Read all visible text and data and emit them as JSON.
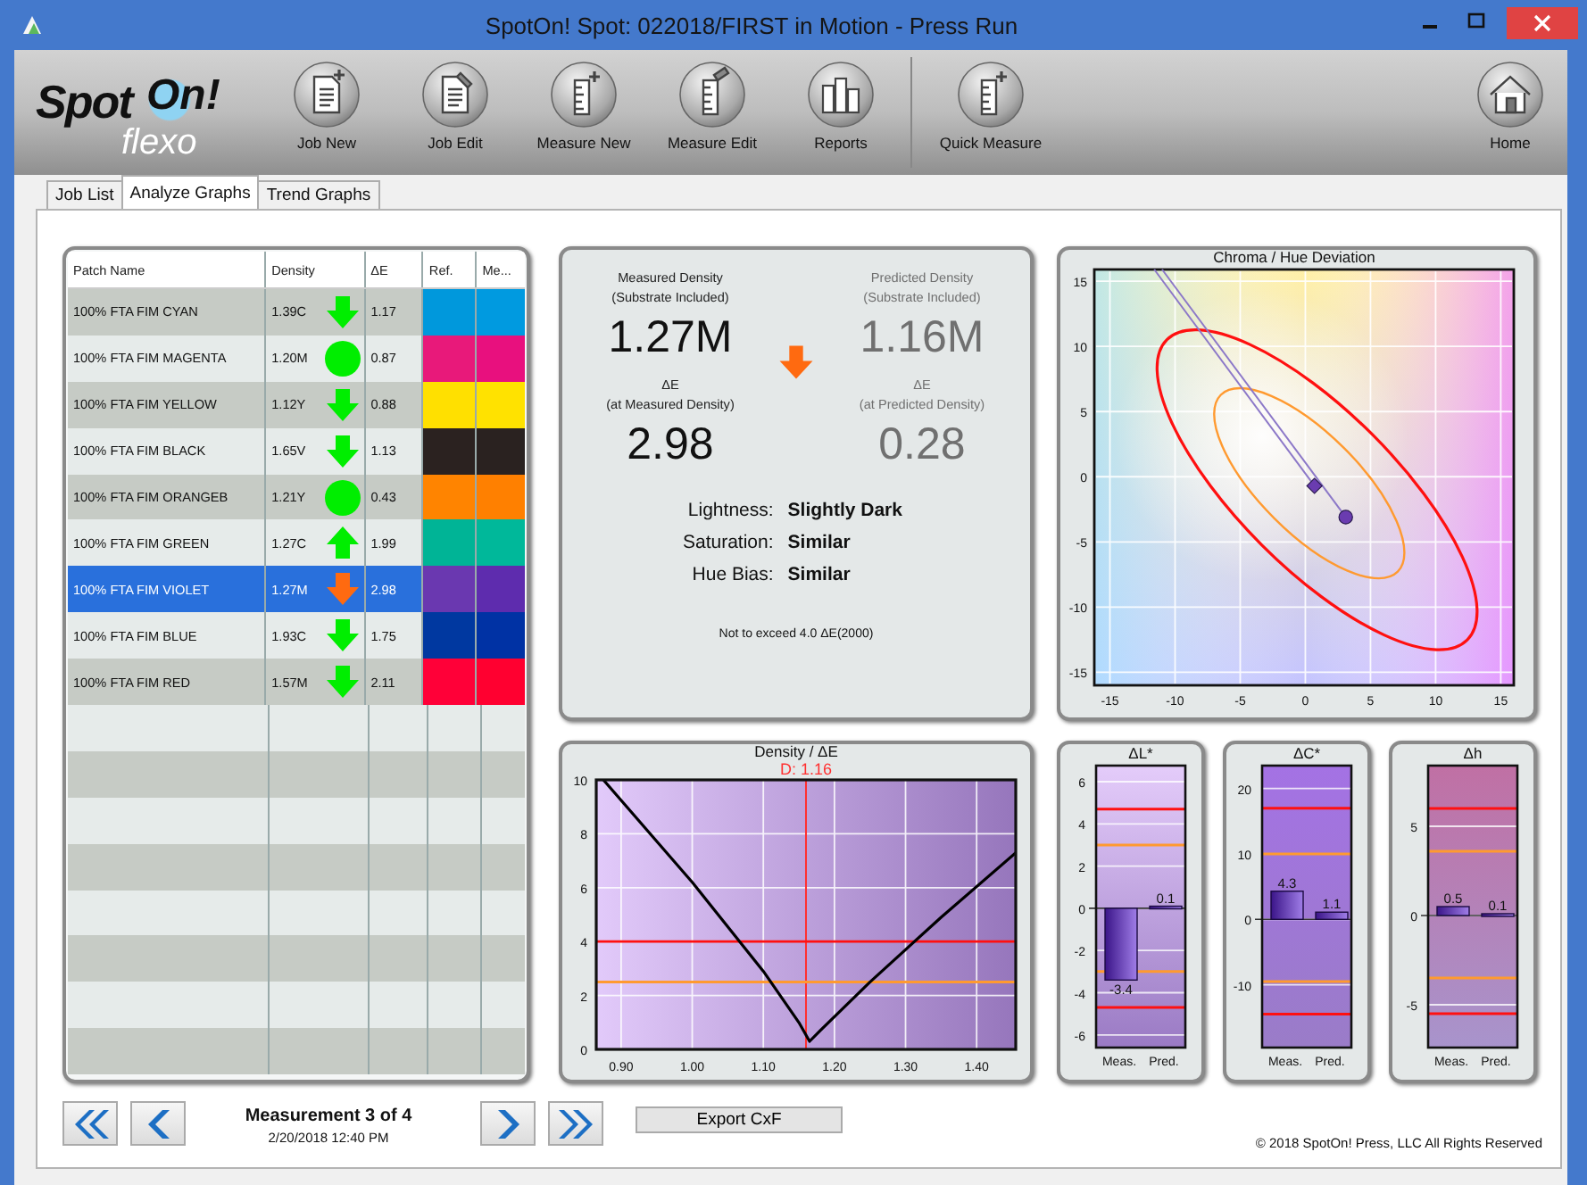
{
  "window": {
    "title": "SpotOn! Spot: 022018/FIRST in Motion - Press Run"
  },
  "logo": {
    "lead": "Spot",
    "badge": "On!",
    "sub": "flexo"
  },
  "toolbar": {
    "main": [
      {
        "label": "Job New",
        "kind": "doc-plus"
      },
      {
        "label": "Job Edit",
        "kind": "doc-edit"
      },
      {
        "label": "Measure New",
        "kind": "ruler-plus"
      },
      {
        "label": "Measure Edit",
        "kind": "ruler-edit"
      },
      {
        "label": "Reports",
        "kind": "bars"
      }
    ],
    "quick": [
      {
        "label": "Quick Measure",
        "kind": "ruler-plus"
      }
    ],
    "end": [
      {
        "label": "Home",
        "kind": "home"
      }
    ]
  },
  "tabs": [
    {
      "label": "Job List",
      "selected": false
    },
    {
      "label": "Analyze Graphs",
      "selected": true
    },
    {
      "label": "Trend Graphs",
      "selected": false
    }
  ],
  "patch_table": {
    "columns": [
      "Patch Name",
      "Density",
      "ΔE",
      "Ref.",
      "Me..."
    ],
    "rows": [
      {
        "name": "100% FTA FIM CYAN",
        "density": "1.39C",
        "trend": {
          "kind": "down",
          "color": "#00ee00"
        },
        "delta_e": "1.17",
        "ref": {
          "color": "#0098dc"
        },
        "measured": {
          "color": "#009ae0"
        },
        "selected": false
      },
      {
        "name": "100% FTA FIM MAGENTA",
        "density": "1.20M",
        "trend": {
          "kind": "level",
          "color": "#00ee00"
        },
        "delta_e": "0.87",
        "ref": {
          "color": "#e8197a"
        },
        "measured": {
          "color": "#e8107e"
        },
        "selected": false
      },
      {
        "name": "100% FTA FIM YELLOW",
        "density": "1.12Y",
        "trend": {
          "kind": "down",
          "color": "#00ee00"
        },
        "delta_e": "0.88",
        "ref": {
          "color": "#ffe000"
        },
        "measured": {
          "color": "#ffe200"
        },
        "selected": false
      },
      {
        "name": "100% FTA FIM BLACK",
        "density": "1.65V",
        "trend": {
          "kind": "down",
          "color": "#00ee00"
        },
        "delta_e": "1.13",
        "ref": {
          "color": "#2b2220"
        },
        "measured": {
          "color": "#2a2220"
        },
        "selected": false
      },
      {
        "name": "100% FTA FIM ORANGEB",
        "density": "1.21Y",
        "trend": {
          "kind": "level",
          "color": "#00ee00"
        },
        "delta_e": "0.43",
        "ref": {
          "color": "#ff8400"
        },
        "measured": {
          "color": "#ff8000"
        },
        "selected": false
      },
      {
        "name": "100% FTA FIM GREEN",
        "density": "1.27C",
        "trend": {
          "kind": "up",
          "color": "#00ee00"
        },
        "delta_e": "1.99",
        "ref": {
          "color": "#00b496"
        },
        "measured": {
          "color": "#00b89a"
        },
        "selected": false
      },
      {
        "name": "100% FTA FIM VIOLET",
        "density": "1.27M",
        "trend": {
          "kind": "down",
          "color": "#ff6a10"
        },
        "delta_e": "2.98",
        "ref": {
          "color": "#6a38b0"
        },
        "measured": {
          "color": "#5e2cae"
        },
        "selected": true
      },
      {
        "name": "100% FTA FIM BLUE",
        "density": "1.93C",
        "trend": {
          "kind": "down",
          "color": "#00ee00"
        },
        "delta_e": "1.75",
        "ref": {
          "color": "#0038a0"
        },
        "measured": {
          "color": "#0032a4"
        },
        "selected": false
      },
      {
        "name": "100% FTA FIM RED",
        "density": "1.57M",
        "trend": {
          "kind": "down",
          "color": "#00ee00"
        },
        "delta_e": "2.11",
        "ref": {
          "color": "#ff0038"
        },
        "measured": {
          "color": "#ff0030"
        },
        "selected": false
      }
    ]
  },
  "summary": {
    "measured": {
      "title": "Measured Density",
      "subtitle": "(Substrate Included)",
      "value": "1.27M",
      "de_title": "ΔE",
      "de_subtitle": "(at Measured Density)",
      "de_value": "2.98"
    },
    "predicted": {
      "title": "Predicted Density",
      "subtitle": "(Substrate Included)",
      "value": "1.16M",
      "de_title": "ΔE",
      "de_subtitle": "(at Predicted Density)",
      "de_value": "0.28"
    },
    "trend": {
      "kind": "down",
      "color": "#ff6a10"
    },
    "attributes": [
      {
        "label": "Lightness:",
        "value": "Slightly Dark"
      },
      {
        "label": "Saturation:",
        "value": "Similar"
      },
      {
        "label": "Hue Bias:",
        "value": "Similar"
      }
    ],
    "note": "Not to exceed 4.0 ΔE(2000)"
  },
  "chroma": {
    "chart_data": {
      "type": "scatter",
      "title": "Chroma / Hue Deviation",
      "x": [
        -11.6,
        -11.0,
        0.7,
        3.1
      ],
      "series": [
        {
          "type": "line",
          "color": "#8c78c8",
          "values": [
            15.9,
            null,
            -0.7,
            null
          ]
        },
        {
          "type": "line",
          "color": "#8c78c8",
          "values": [
            null,
            15.9,
            null,
            -3.1
          ]
        },
        {
          "color": "#6a3cb0",
          "values": [
            null,
            null,
            -0.7,
            null
          ]
        },
        {
          "color": "#6a3cb0",
          "values": [
            null,
            null,
            null,
            -3.1
          ]
        }
      ],
      "xlim": [
        -16.2,
        16
      ],
      "ylim": [
        -16,
        15.9
      ],
      "xticks": [
        -15,
        -10,
        -5,
        0,
        5,
        10,
        15
      ],
      "yticks": [
        -15,
        -10,
        -5,
        0,
        5,
        10,
        15
      ],
      "grid": true
    }
  },
  "density": {
    "chart_data": {
      "type": "line",
      "title": "Density / ΔE",
      "x": [
        0.875,
        1.0,
        1.1,
        1.15,
        1.165,
        1.18,
        1.25,
        1.35,
        1.455
      ],
      "series": [
        {
          "color": "#000000",
          "values": [
            10,
            6.2,
            2.9,
            1.0,
            0.3,
            0.7,
            2.5,
            4.9,
            7.3
          ]
        }
      ],
      "xlim": [
        0.865,
        1.455
      ],
      "ylim": [
        0,
        10
      ],
      "xticks": [
        {
          "value": 0.9,
          "label": "0.90"
        },
        {
          "value": 1.0,
          "label": "1.00"
        },
        {
          "value": 1.1,
          "label": "1.10"
        },
        {
          "value": 1.2,
          "label": "1.20"
        },
        {
          "value": 1.3,
          "label": "1.30"
        },
        {
          "value": 1.4,
          "label": "1.40"
        }
      ],
      "yticks": [
        0,
        2,
        4,
        6,
        8,
        10
      ],
      "grid": true,
      "ref_lines": [
        {
          "axis": "x",
          "value": 1.16,
          "label": "D: 1.16",
          "color": "#ff3030"
        },
        {
          "axis": "y",
          "value": 4,
          "color": "#ff1010"
        },
        {
          "axis": "y",
          "value": 2.5,
          "color": "#ff9a30"
        }
      ]
    }
  },
  "deviations": [
    {
      "chart_data": {
        "type": "bar",
        "title": "ΔL*",
        "categories": [
          "Meas.",
          "Pred."
        ],
        "values": [
          -3.4,
          0.1
        ],
        "ylim": [
          -6.6,
          6.76
        ],
        "yticks": [
          -6,
          -4,
          -2,
          0,
          2,
          4,
          6
        ],
        "data_labels": true,
        "grid": true,
        "ref_lines": [
          {
            "axis": "y",
            "value": 4.7,
            "color": "#ff1010"
          },
          {
            "axis": "y",
            "value": -4.7,
            "color": "#ff1010"
          },
          {
            "axis": "y",
            "value": 3,
            "color": "#ff9a30"
          },
          {
            "axis": "y",
            "value": -3,
            "color": "#ff9a30"
          }
        ]
      }
    },
    {
      "chart_data": {
        "type": "bar",
        "title": "ΔC*",
        "categories": [
          "Meas.",
          "Pred."
        ],
        "values": [
          4.3,
          1.1
        ],
        "ylim": [
          -19.6,
          23.5
        ],
        "yticks": [
          -10,
          0,
          10,
          20
        ],
        "data_labels": true,
        "grid": true,
        "ref_lines": [
          {
            "axis": "y",
            "value": 17,
            "color": "#ff1010"
          },
          {
            "axis": "y",
            "value": -14.5,
            "color": "#ff1010"
          },
          {
            "axis": "y",
            "value": 10,
            "color": "#ff9a30"
          },
          {
            "axis": "y",
            "value": -9.5,
            "color": "#ff9a30"
          }
        ]
      }
    },
    {
      "chart_data": {
        "type": "bar",
        "title": "Δh",
        "categories": [
          "Meas.",
          "Pred."
        ],
        "values": [
          0.5,
          0.1
        ],
        "ylim": [
          -7.4,
          8.4
        ],
        "yticks": [
          -5,
          0,
          5
        ],
        "data_labels": true,
        "grid": true,
        "ref_lines": [
          {
            "axis": "y",
            "value": 6,
            "color": "#ff1010"
          },
          {
            "axis": "y",
            "value": -5.5,
            "color": "#ff1010"
          },
          {
            "axis": "y",
            "value": 3.6,
            "color": "#ff9a30"
          },
          {
            "axis": "y",
            "value": -3.5,
            "color": "#ff9a30"
          }
        ]
      }
    }
  ],
  "footer": {
    "measurement": "Measurement 3 of 4",
    "timestamp": "2/20/2018 12:40 PM",
    "export": "Export CxF",
    "copyright": "© 2018 SpotOn! Press, LLC All Rights Reserved"
  }
}
